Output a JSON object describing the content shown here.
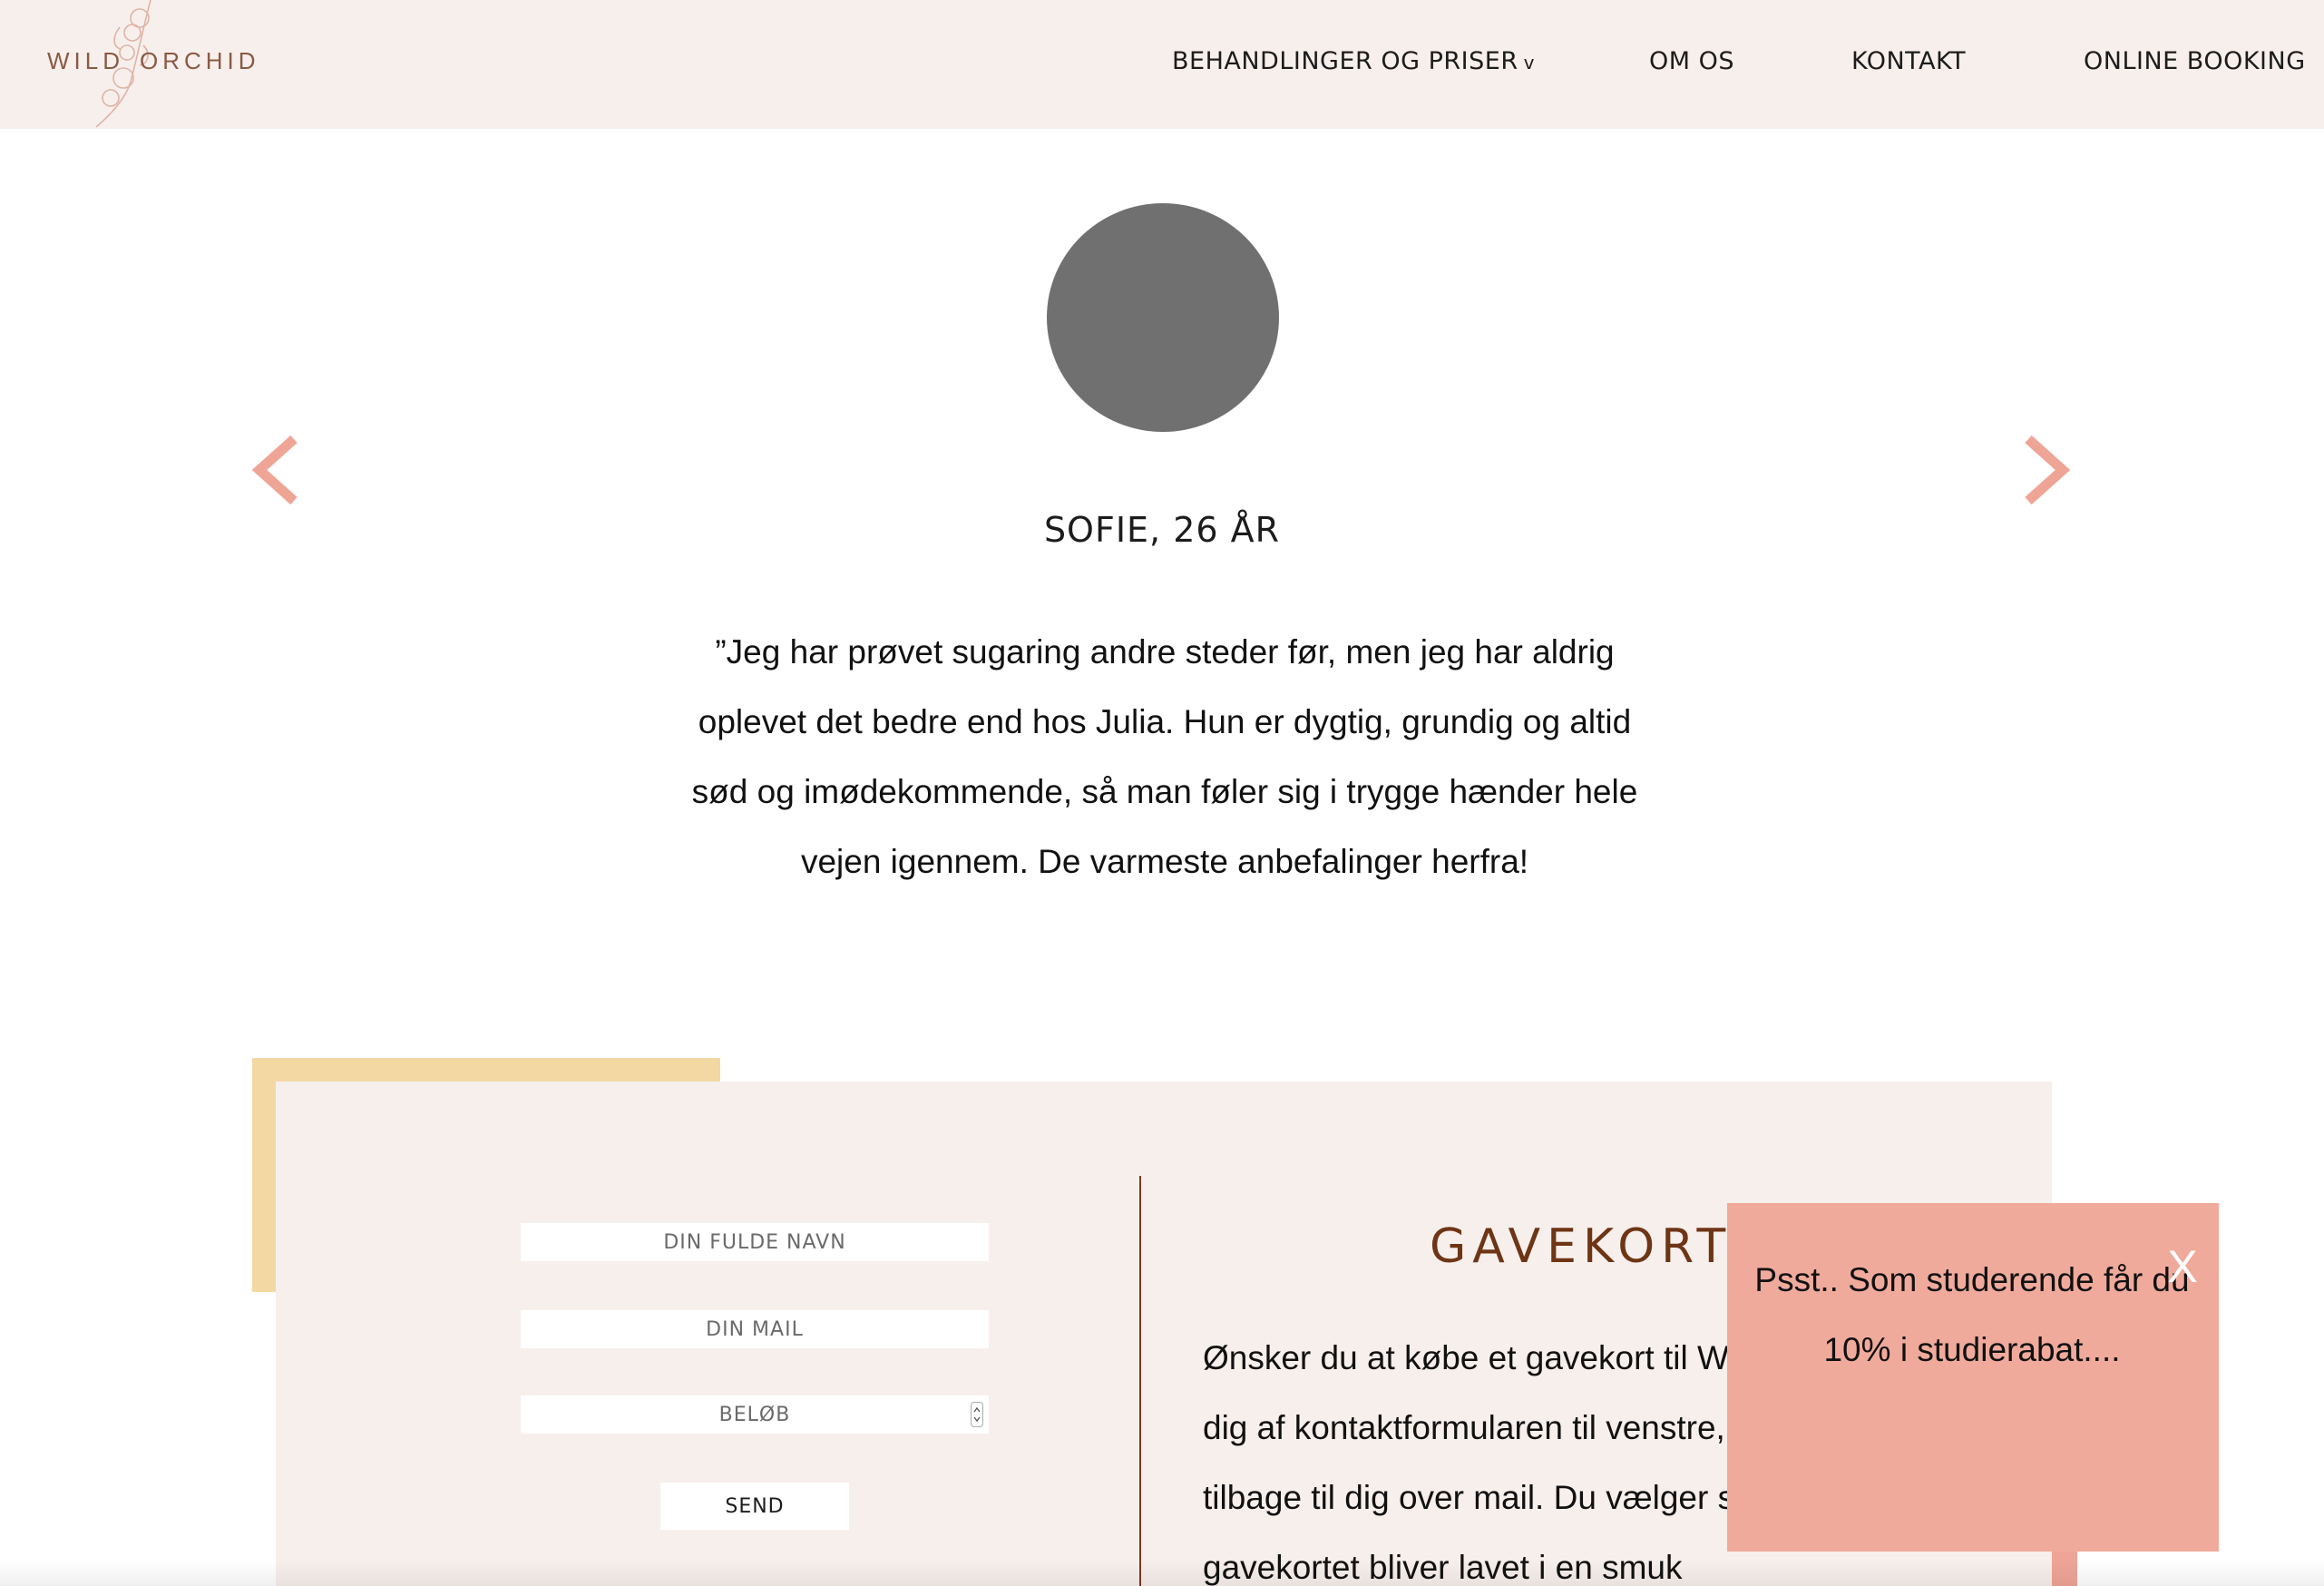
{
  "brand": {
    "logo_word_1": "WILD",
    "logo_word_2": "ORCHID"
  },
  "nav": {
    "items": [
      {
        "label": "BEHANDLINGER OG PRISER",
        "caret": "v"
      },
      {
        "label": "OM OS"
      },
      {
        "label": "KONTAKT"
      },
      {
        "label": "ONLINE BOOKING"
      }
    ]
  },
  "testimonial": {
    "name": "SOFIE, 26 ÅR",
    "quote": "”Jeg har prøvet sugaring andre steder før, men jeg har aldrig oplevet det bedre end hos Julia. Hun er dygtig, grundig og altid sød og imødekommende, så man føler sig i trygge hænder hele vejen igennem. De varmeste anbefalinger herfra!"
  },
  "giftcard_form": {
    "name_placeholder": "DIN FULDE NAVN",
    "mail_placeholder": "DIN MAIL",
    "amount_placeholder": "BELØB",
    "send_label": "SEND"
  },
  "giftcard_info": {
    "title": "GAVEKORT",
    "body": "Ønsker du at købe et gavekort til Wild Orchid, benyt dig af kontaktformularen til venstre, så vender vi tilbage til dig over mail. Du vælger selv beløbet, og gavekortet bliver lavet i en smuk"
  },
  "popup": {
    "text": "Psst.. Som studerende får du 10% i studierabat....",
    "close_label": "X"
  },
  "colors": {
    "header_bg": "#f7efec",
    "accent_pink": "#efa596",
    "accent_yellow": "#f3d8a4",
    "title_brown": "#6e3515",
    "avatar_gray": "#707070"
  },
  "icons": {
    "logo_flower": "orchid-branch-icon",
    "prev": "chevron-left-icon",
    "next": "chevron-right-icon",
    "close": "close-icon"
  }
}
